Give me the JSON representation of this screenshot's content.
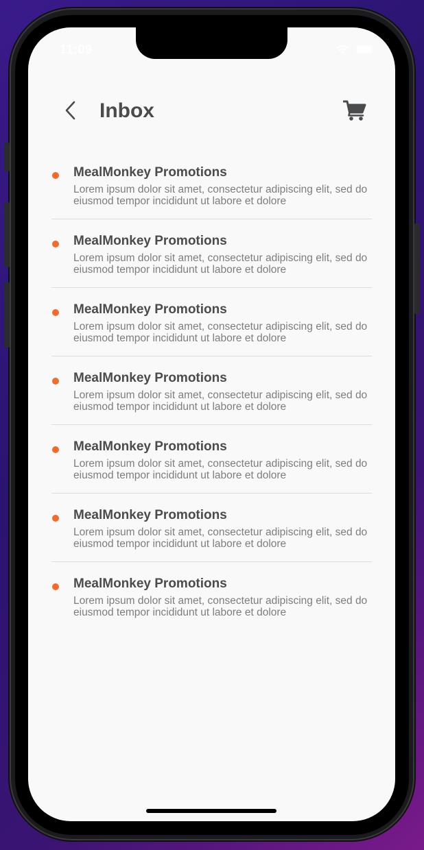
{
  "status_bar": {
    "time": "11:09"
  },
  "header": {
    "title": "Inbox"
  },
  "icons": {
    "back": "chevron-left-icon",
    "cart": "shopping-cart-icon",
    "wifi": "wifi-icon",
    "battery": "battery-icon"
  },
  "colors": {
    "accent": "#f26b2a",
    "title_text": "#4a4b4d",
    "body_text": "#7c7d7e",
    "background": "#f9f9f9",
    "divider": "#dcdcdc"
  },
  "messages": [
    {
      "title": "MealMonkey Promotions",
      "body": "Lorem ipsum dolor sit amet, consectetur adipiscing elit, sed do eiusmod tempor incididunt ut labore et dolore",
      "unread": true
    },
    {
      "title": "MealMonkey Promotions",
      "body": "Lorem ipsum dolor sit amet, consectetur adipiscing elit, sed do eiusmod tempor incididunt ut labore et dolore",
      "unread": true
    },
    {
      "title": "MealMonkey Promotions",
      "body": "Lorem ipsum dolor sit amet, consectetur adipiscing elit, sed do eiusmod tempor incididunt ut labore et dolore",
      "unread": true
    },
    {
      "title": "MealMonkey Promotions",
      "body": "Lorem ipsum dolor sit amet, consectetur adipiscing elit, sed do eiusmod tempor incididunt ut labore et dolore",
      "unread": true
    },
    {
      "title": "MealMonkey Promotions",
      "body": "Lorem ipsum dolor sit amet, consectetur adipiscing elit, sed do eiusmod tempor incididunt ut labore et dolore",
      "unread": true
    },
    {
      "title": "MealMonkey Promotions",
      "body": "Lorem ipsum dolor sit amet, consectetur adipiscing elit, sed do eiusmod tempor incididunt ut labore et dolore",
      "unread": true
    },
    {
      "title": "MealMonkey Promotions",
      "body": "Lorem ipsum dolor sit amet, consectetur adipiscing elit, sed do eiusmod tempor incididunt ut labore et dolore",
      "unread": true
    }
  ]
}
